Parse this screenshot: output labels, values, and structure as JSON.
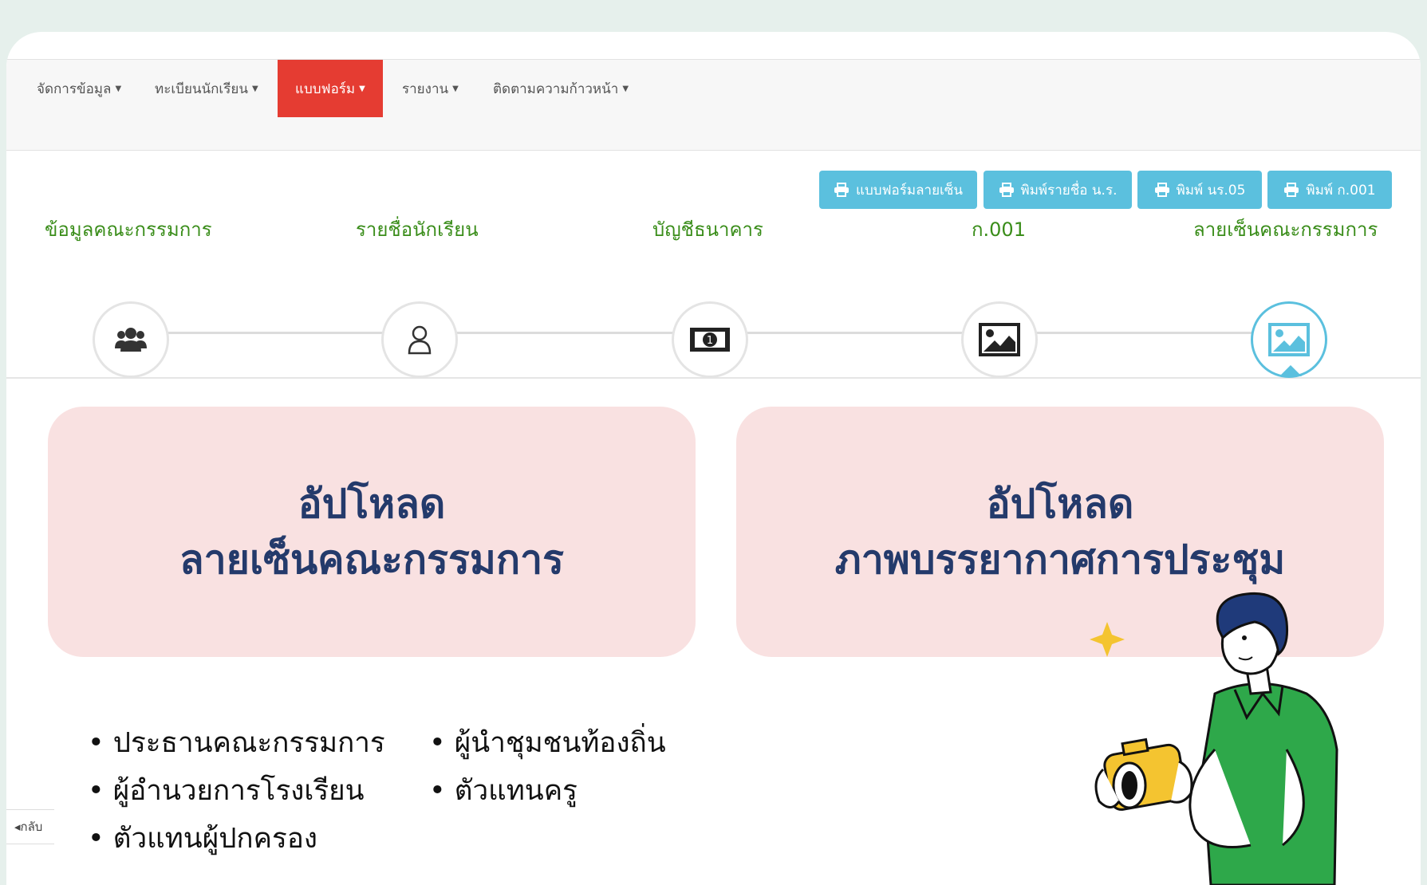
{
  "nav": {
    "items": [
      {
        "label": "จัดการข้อมูล"
      },
      {
        "label": "ทะเบียนนักเรียน"
      },
      {
        "label": "แบบฟอร์ม"
      },
      {
        "label": "รายงาน"
      },
      {
        "label": "ติดตามความก้าวหน้า"
      }
    ],
    "active_index": 2
  },
  "print_buttons": [
    {
      "label": "แบบฟอร์มลายเซ็น"
    },
    {
      "label": "พิมพ์รายชื่อ น.ร."
    },
    {
      "label": "พิมพ์ นร.05"
    },
    {
      "label": "พิมพ์ ก.001"
    }
  ],
  "steps": [
    {
      "label": "ข้อมูลคณะกรรมการ",
      "icon": "users-icon"
    },
    {
      "label": "รายชื่อนักเรียน",
      "icon": "user-icon"
    },
    {
      "label": "บัญชีธนาคาร",
      "icon": "money-icon"
    },
    {
      "label": "ก.001",
      "icon": "image-icon"
    },
    {
      "label": "ลายเซ็นคณะกรรมการ",
      "icon": "image-icon"
    }
  ],
  "active_step": 4,
  "panels": {
    "left": {
      "line1": "อัปโหลด",
      "line2": "ลายเซ็นคณะกรรมการ"
    },
    "right": {
      "line1": "อัปโหลด",
      "line2": "ภาพบรรยากาศการประชุม"
    }
  },
  "committee_list": {
    "col1": [
      "• ประธานคณะกรรมการ",
      "• ผู้อำนวยการโรงเรียน",
      "• ตัวแทนผู้ปกครอง"
    ],
    "col2": [
      "• ผู้นำชุมชนท้องถิ่น",
      "• ตัวแทนครู"
    ]
  },
  "back_label": "◂กลับ",
  "colors": {
    "accent_nav": "#e53c32",
    "print_button": "#5bc0de",
    "step_label": "#3a8d1a",
    "panel_bg": "#f9e1e1",
    "panel_text": "#243a6b",
    "shirt": "#2ea84a",
    "camera": "#f4c430"
  }
}
